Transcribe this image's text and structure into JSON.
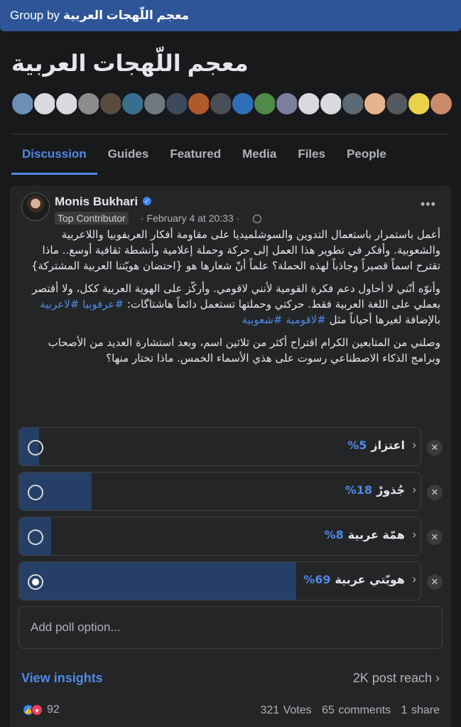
{
  "topbar": {
    "prefix": "Group by",
    "group_name": "معجم اللّهجات العربية"
  },
  "group": {
    "title": "معجم اللّهجات العربية",
    "member_avatars": [
      {
        "name": "member-photo",
        "color": "#6b8fb5"
      },
      {
        "name": "member-placeholder",
        "color": "#d8dadf"
      },
      {
        "name": "member-placeholder",
        "color": "#d8dadf"
      },
      {
        "name": "member-photo",
        "color": "#8c8c8c"
      },
      {
        "name": "member-photo",
        "color": "#5a4b3f"
      },
      {
        "name": "member-photo",
        "color": "#3a6e8f"
      },
      {
        "name": "member-photo",
        "color": "#6f7a80"
      },
      {
        "name": "member-photo",
        "color": "#3d4a5c"
      },
      {
        "name": "member-photo",
        "color": "#b05a2c"
      },
      {
        "name": "member-photo",
        "color": "#4a4f57"
      },
      {
        "name": "member-photo",
        "color": "#2f6fb8"
      },
      {
        "name": "member-photo",
        "color": "#4f8a4a"
      },
      {
        "name": "member-photo",
        "color": "#7b7fa0"
      },
      {
        "name": "member-placeholder",
        "color": "#d8dadf"
      },
      {
        "name": "member-placeholder",
        "color": "#d8dadf"
      },
      {
        "name": "member-photo",
        "color": "#5c6a75"
      },
      {
        "name": "member-photo",
        "color": "#e6b48c"
      },
      {
        "name": "member-photo",
        "color": "#55595e"
      },
      {
        "name": "member-photo",
        "color": "#e8d24a"
      },
      {
        "name": "member-photo",
        "color": "#c98b6a"
      }
    ]
  },
  "tabs": [
    {
      "label": "Discussion",
      "active": true
    },
    {
      "label": "Guides",
      "active": false
    },
    {
      "label": "Featured",
      "active": false
    },
    {
      "label": "Media",
      "active": false
    },
    {
      "label": "Files",
      "active": false
    },
    {
      "label": "People",
      "active": false
    }
  ],
  "post": {
    "author": "Monis Bukhari",
    "badge": "Top Contributor",
    "date": "· February 4 at 20:33 ·",
    "paragraph1": "أعمل باستمرار باستعمال التدوين والسوشلميديا على مقاومة أفكار العربفوبيا واللاعربية والشعوبية. وأفكر في تطوير هذا العمل إلى حركة وحملة إعلامية وأنشطة ثقافية أوسع.. ماذا تقترح اسماً قصيراً وجاذباً لهذه الحملة؟ علماً أنّ شعارها هو {احتضان هويّتنا العربية المشتركة}",
    "paragraph2_text": "وأنوّه أنّني لا أحاول دعم فكرة القومية لأنني لاقومي. وأركّز على الهوية العربية ككل، ولا أقتصر بعملي على اللغة العربية فقط. حركتي وحملتها تستعمل دائماً هاشتاگات:",
    "hashtags_line": "#عرفوبيا #لاعربية",
    "paragraph2_mid": "بالإضافة لغيرها أحياناً مثل",
    "hashtags_line2": "#لاقومية #شعوبية",
    "paragraph3": "وصلني من المتابعين الكرام اقتراح أكثر من ثلاثين اسم، وبعد استشارة العديد من الأصحاب وبرامج الذكاء الاصطناعي رسوت على هذي الأسماء الخمس. ماذا تختار منها؟"
  },
  "poll": {
    "options": [
      {
        "label": "اعتزاز",
        "percent_text": "5%",
        "fraction": 0.05,
        "selected": false
      },
      {
        "label": "جُذورْ",
        "percent_text": "18%",
        "fraction": 0.18,
        "selected": false
      },
      {
        "label": "همّة عربية",
        "percent_text": "8%",
        "fraction": 0.08,
        "selected": false
      },
      {
        "label": "هويّتي عربية",
        "percent_text": "69%",
        "fraction": 0.69,
        "selected": true
      }
    ],
    "add_placeholder": "Add poll option..."
  },
  "footer": {
    "view_insights": "View insights",
    "reach": "2K post reach",
    "reaction_count": "92",
    "votes": "321 Votes",
    "comments": "65 comments",
    "shares": "1 share"
  }
}
